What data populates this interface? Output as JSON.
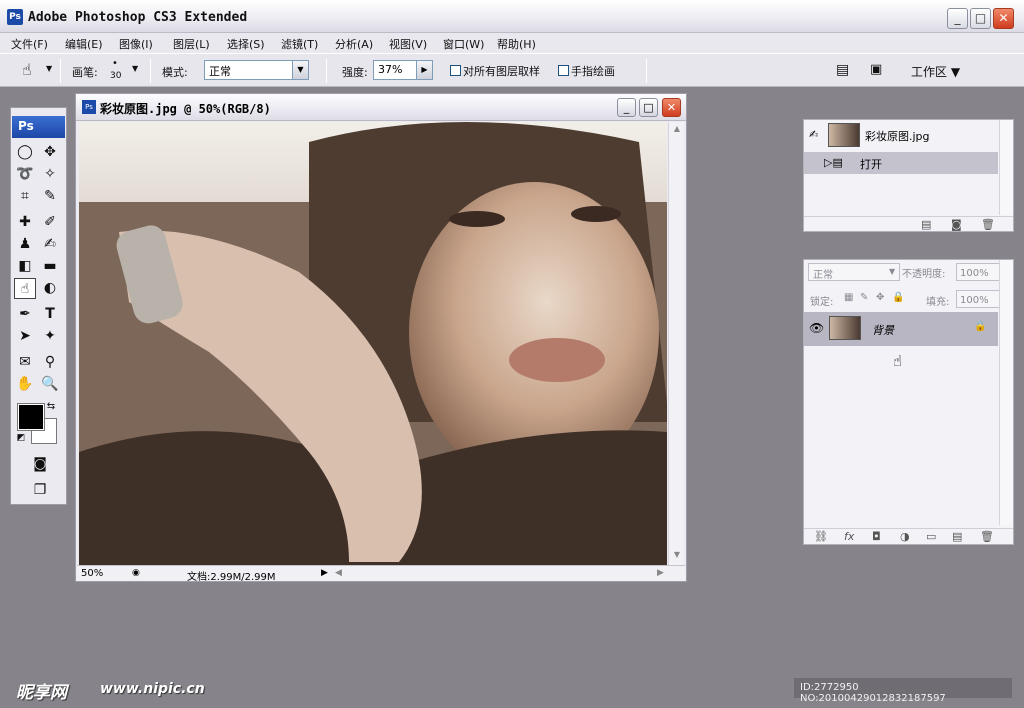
{
  "window": {
    "app_icon": "Ps",
    "title": "Adobe Photoshop CS3 Extended",
    "minimize_glyph": "_",
    "maximize_glyph": "□",
    "close_glyph": "✕"
  },
  "menu": [
    "文件(F)",
    "编辑(E)",
    "图像(I)",
    "图层(L)",
    "选择(S)",
    "滤镜(T)",
    "分析(A)",
    "视图(V)",
    "窗口(W)",
    "帮助(H)"
  ],
  "options": {
    "brush_label": "画笔:",
    "brush_size": "30",
    "mode_label": "模式:",
    "mode_value": "正常",
    "strength_label": "强度:",
    "strength_value": "37%",
    "sample_all_label": "对所有图层取样",
    "finger_paint_label": "手指绘画",
    "workspace_label": "工作区 ▼"
  },
  "toolbox": {
    "header": "Ps",
    "active_tool": "smudge-tool"
  },
  "document": {
    "title": "彩妆原图.jpg @ 50%(RGB/8)",
    "zoom": "50%",
    "doc_size": "文档:2.99M/2.99M"
  },
  "history_panel": {
    "snapshot_name": "彩妆原图.jpg",
    "state": "打开"
  },
  "layers_panel": {
    "blend_mode": "正常",
    "opacity_label": "不透明度:",
    "opacity_value": "100%",
    "lock_label": "锁定:",
    "fill_label": "填充:",
    "fill_value": "100%",
    "layer_name": "背景"
  },
  "footer": {
    "watermark": "昵享网",
    "watermark_url": "www.nipic.cn",
    "id_text": "ID:2772950 NO:20100429012832187597"
  }
}
